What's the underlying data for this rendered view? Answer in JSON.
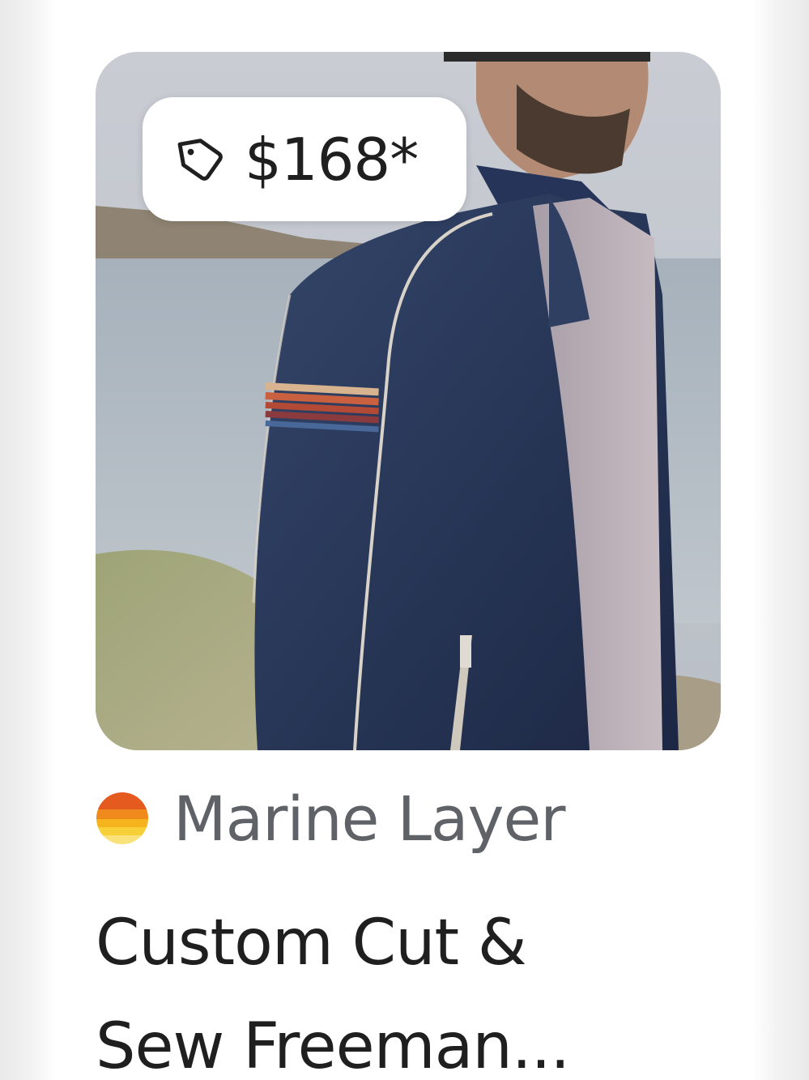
{
  "product": {
    "price": "$168*",
    "brand": "Marine Layer",
    "title_line1": "Custom Cut &",
    "title_line2": "Sew Freeman..."
  },
  "icons": {
    "price": "tag-icon",
    "brand": "brand-logo-icon"
  },
  "colors": {
    "text_primary": "#1f1f1f",
    "text_secondary": "#5f6368",
    "pill_bg": "#ffffff",
    "brand_logo_stripes": [
      "#e55a1f",
      "#f08a1c",
      "#f5b41e",
      "#f7cf38",
      "#f9e27a"
    ]
  }
}
